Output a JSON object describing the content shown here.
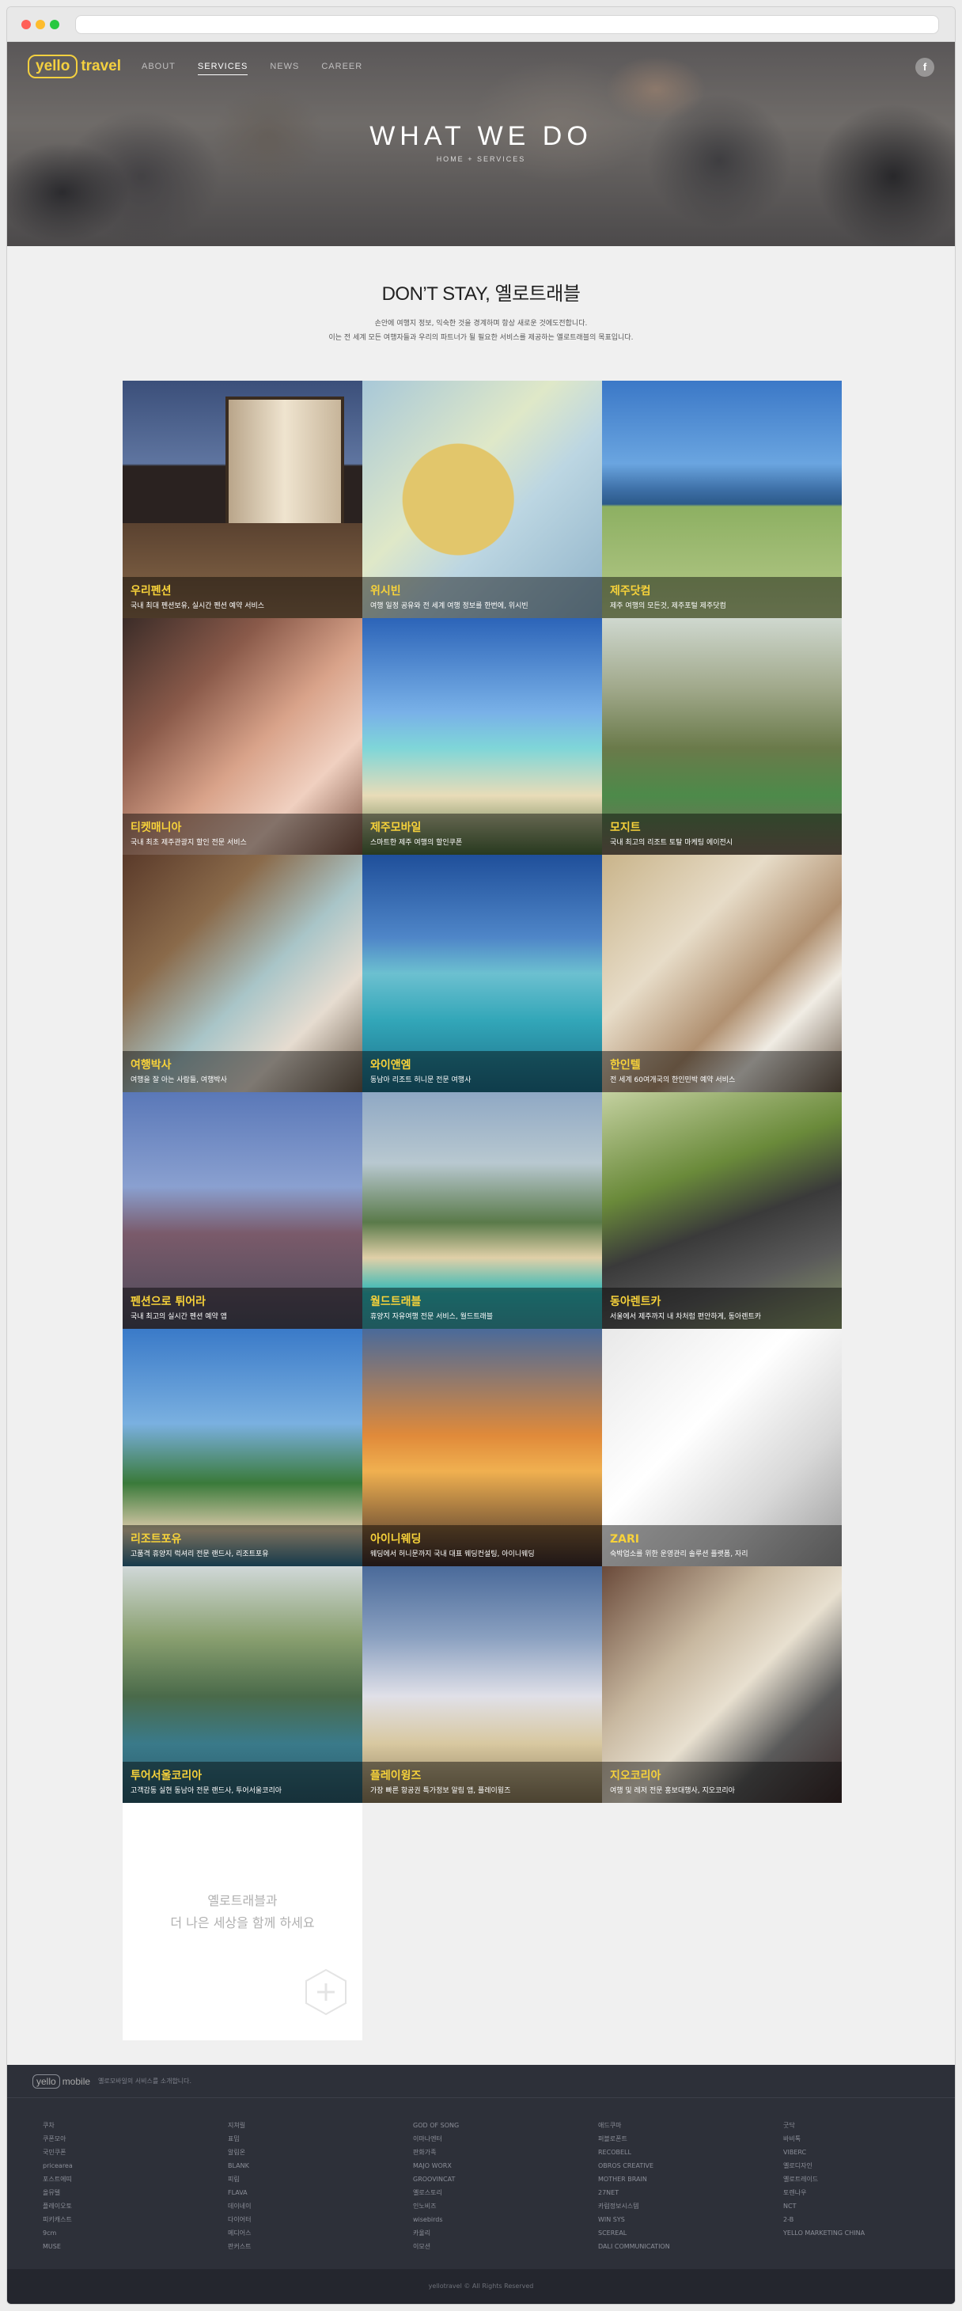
{
  "brand": {
    "logo_box": "yello",
    "logo_text": "travel"
  },
  "nav": {
    "items": [
      "ABOUT",
      "SERVICES",
      "NEWS",
      "CAREER"
    ],
    "active": "SERVICES",
    "facebook_icon": "f"
  },
  "hero": {
    "title": "WHAT WE DO",
    "breadcrumb": "HOME + SERVICES"
  },
  "intro": {
    "heading": "DON’T STAY, 옐로트래블",
    "line1": "손안에 여행지 정보, 익숙한 것을 경계하며 항상 새로운 것에도전합니다.",
    "line2": "이는 전 세계 모든 여행자들과 우리의 파트너가 될 필요한 서비스를 제공하는 옐로트래블의 목표입니다."
  },
  "services": [
    {
      "title": "우리펜션",
      "desc": "국내 최대 펜션보유, 실시간 펜션 예약 서비스"
    },
    {
      "title": "위시빈",
      "desc": "여행 일정 공유와 전 세계 여행 정보를 한번에, 위시빈"
    },
    {
      "title": "제주닷컴",
      "desc": "제주 여행의 모든것, 제주포털 제주닷컴"
    },
    {
      "title": "티켓매니아",
      "desc": "국내 최초 제주관광지 할인 전문 서비스"
    },
    {
      "title": "제주모바일",
      "desc": "스마트한 제주 여행의 할인쿠폰"
    },
    {
      "title": "모지트",
      "desc": "국내 최고의 리조트 토탈 마케팅 에이전시"
    },
    {
      "title": "여행박사",
      "desc": "여행을 잘 아는 사람들, 여행박사"
    },
    {
      "title": "와이앤엠",
      "desc": "동남아 리조트 허니문 전문 여행사"
    },
    {
      "title": "한인텔",
      "desc": "전 세계 60여개국의 한인민박 예약 서비스"
    },
    {
      "title": "펜션으로 튀어라",
      "desc": "국내 최고의 실시간 펜션 예약 앱"
    },
    {
      "title": "월드트래블",
      "desc": "휴양지 자유여행 전문 서비스, 월드트래블"
    },
    {
      "title": "동아렌트카",
      "desc": "서울에서 제주까지 내 차처럼 편안하게, 동아렌트카"
    },
    {
      "title": "리조트포유",
      "desc": "고품격 휴양지 럭셔리 전문 랜드사, 리조트포유"
    },
    {
      "title": "아이니웨딩",
      "desc": "웨딩에서 허니문까지 국내 대표 웨딩컨설팅, 아이니웨딩"
    },
    {
      "title": "ZARI",
      "desc": "숙박업소를 위한 운영관리 솔루션 플랫폼, 자리"
    },
    {
      "title": "투어서울코리아",
      "desc": "고객감동 실현 동남아 전문 랜드사, 투어서울코리아"
    },
    {
      "title": "플레이윙즈",
      "desc": "가장 빠른 항공권 특가정보 알림 앱, 플레이윙즈"
    },
    {
      "title": "지오코리아",
      "desc": "여행 및 레저 전문 홍보대행사, 지오코리아"
    }
  ],
  "more": {
    "line1": "옐로트래블과",
    "line2": "더 나은 세상을 함께 하세요",
    "icon": "plus-hexagon-icon"
  },
  "footer": {
    "logo_box": "yello",
    "logo_text": "mobile",
    "description": "옐로모바일의 서비스를 소개합니다.",
    "columns": [
      [
        "쿠차",
        "쿠폰모아",
        "국민쿠폰",
        "pricearea",
        "포스트에띠",
        "올뮤텔",
        "플레이오토",
        "피키캐스트",
        "9cm",
        "MUSE"
      ],
      [
        "지쳐릴",
        "표밈",
        "알림온",
        "BLANK",
        "피림",
        "FLAVA",
        "데이네이",
        "다이어터",
        "메디어스",
        "판커스트"
      ],
      [
        "GOD OF SONG",
        "이마나엔터",
        "판화가족",
        "MAJO WORX",
        "GROOVINCAT",
        "옐로스토리",
        "인노비즈",
        "wisebirds",
        "카울리",
        "이모션"
      ],
      [
        "애드쿠마",
        "퍼블로폰트",
        "RECOBELL",
        "OBROS CREATIVE",
        "MOTHER BRAIN",
        "27NET",
        "카럼정보시스템",
        "WIN SYS",
        "SCEREAL",
        "DALI COMMUNICATION"
      ],
      [
        "굿닥",
        "바비톡",
        "VIBERC",
        "옐로디자인",
        "옐로트레이드",
        "토렌나우",
        "NCT",
        "2-B",
        "YELLO MARKETING CHINA"
      ]
    ],
    "copyright": "yellotravel © All Rights Reserved"
  },
  "colors": {
    "accent": "#f4d03f",
    "caption_title": "#f7d23a",
    "footer_bg": "#2d3039",
    "page_bg": "#f0f0f0"
  }
}
